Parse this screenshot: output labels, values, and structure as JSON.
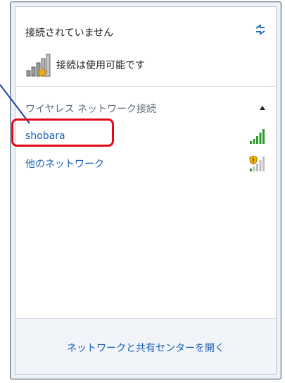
{
  "header": {
    "title": "接続されていません",
    "refresh_icon": "refresh-arrows-icon"
  },
  "connection_status": {
    "text": "接続は使用可能です",
    "icon": "signal-bars-with-star-icon"
  },
  "wireless_section": {
    "header": "ワイヤレス ネットワーク接続",
    "collapse_icon": "chevron-up-icon",
    "networks": [
      {
        "label": "shobara",
        "signal_icon": "wifi-signal-strong-icon",
        "signal_bars_filled": 5,
        "secured": false
      },
      {
        "label": "他のネットワーク",
        "signal_icon": "wifi-signal-shield-icon",
        "signal_bars_filled": 1,
        "secured": true
      }
    ]
  },
  "footer": {
    "link": "ネットワークと共有センターを開く"
  },
  "colors": {
    "link": "#1a5fb4",
    "highlight": "#e00b1a",
    "signal_green": "#2e9b2e"
  }
}
